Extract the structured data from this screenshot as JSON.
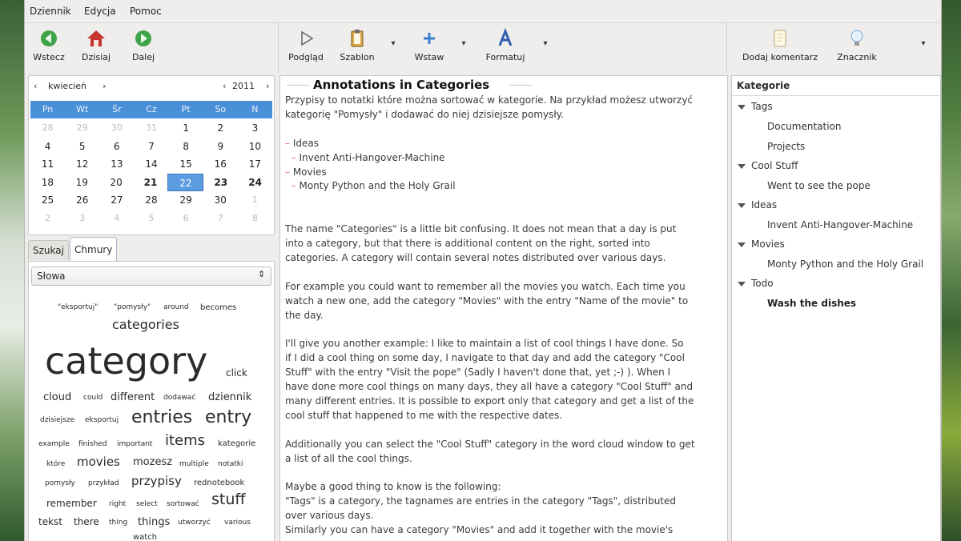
{
  "menubar": {
    "items": [
      "Dziennik",
      "Edycja",
      "Pomoc"
    ]
  },
  "toolbar": {
    "back": "Wstecz",
    "today": "Dzisiaj",
    "forward": "Dalej",
    "preview": "Podgląd",
    "template": "Szablon",
    "insert": "Wstaw",
    "format": "Formatuj",
    "add_comment": "Dodaj komentarz",
    "tag": "Znacznik"
  },
  "calendar": {
    "month": "kwiecień",
    "year": "2011",
    "weekdays": [
      "Pn",
      "Wt",
      "Śr",
      "Cz",
      "Pt",
      "So",
      "N"
    ],
    "weeks": [
      [
        "28",
        "29",
        "30",
        "31",
        "1",
        "2",
        "3"
      ],
      [
        "4",
        "5",
        "6",
        "7",
        "8",
        "9",
        "10"
      ],
      [
        "11",
        "12",
        "13",
        "14",
        "15",
        "16",
        "17"
      ],
      [
        "18",
        "19",
        "20",
        "21",
        "22",
        "23",
        "24"
      ],
      [
        "25",
        "26",
        "27",
        "28",
        "29",
        "30",
        "1"
      ],
      [
        "2",
        "3",
        "4",
        "5",
        "6",
        "7",
        "8"
      ]
    ],
    "selected_day": "22"
  },
  "left_tabs": {
    "search": "Szukaj",
    "clouds": "Chmury"
  },
  "cloud_combo": {
    "value": "Słowa"
  },
  "cloud_words": {
    "w1": "\"eksportuj\"",
    "w2": "\"pomysły\"",
    "w3": "around",
    "w4": "becomes",
    "w5": "categories",
    "w6": "category",
    "w7": "click",
    "w8": "cloud",
    "w9": "could",
    "w10": "different",
    "w11": "dodawać",
    "w12": "dziennik",
    "w13": "dzisiejsze",
    "w14": "eksportuj",
    "w15": "entries",
    "w16": "entry",
    "w17": "example",
    "w18": "finished",
    "w19": "important",
    "w20": "items",
    "w21": "kategorie",
    "w22": "które",
    "w23": "movies",
    "w24": "mozesz",
    "w25": "multiple",
    "w26": "notatki",
    "w27": "pomysły",
    "w28": "przykład",
    "w29": "przypisy",
    "w30": "rednotebook",
    "w31": "remember",
    "w32": "right",
    "w33": "select",
    "w34": "sortować",
    "w35": "stuff",
    "w36": "tekst",
    "w37": "there",
    "w38": "thing",
    "w39": "things",
    "w40": "utworzyć",
    "w41": "various",
    "w42": "watch"
  },
  "editor": {
    "title": "Annotations in Categories",
    "p1a": "Przypisy to notatki które można sortować w kategorie. Na przykład możesz utworzyć",
    "p1b": "kategorię \"Pomysły\" i dodawać do niej dzisiejsze pomysły.",
    "l1": "Ideas",
    "l2": "Invent Anti-Hangover-Machine",
    "l3": "Movies",
    "l4": "Monty Python and the Holy Grail",
    "p2a": "The name \"Categories\" is a little bit confusing. It does not mean that a day is put",
    "p2b": "into a category, but that there is additional content on the right, sorted into",
    "p2c": "categories. A category will contain several notes distributed over various days.",
    "p3a": "For example you could want to remember all the movies you watch. Each time you",
    "p3b": "watch a new one, add the category \"Movies\" with the entry \"Name of the movie\" to",
    "p3c": "the day.",
    "p4a": "I'll give you another example: I like to maintain a list of cool things I have done. So",
    "p4b": "if I did a cool thing on some day, I navigate to that day and add the category \"Cool",
    "p4c": "Stuff\" with the entry \"Visit the pope\" (Sadly I haven't done that, yet ;-) ). When I",
    "p4d": "have done more cool things on many days, they all have a category \"Cool Stuff\" and",
    "p4e": "many different entries. It is possible to export only that category and get a list of the",
    "p4f": "cool stuff that happened to me with the respective dates.",
    "p5a": "Additionally you can select the \"Cool Stuff\" category in the word cloud window to get",
    "p5b": "a list of all the cool things.",
    "p6a": "Maybe a good thing to know is the following:",
    "p6b": "\"Tags\" is a category, the tagnames are entries in the category \"Tags\", distributed",
    "p6c": "over various days.",
    "p6d": "Similarly you can have a category \"Movies\" and add it together with the movie's"
  },
  "categories_panel": {
    "header": "Kategorie",
    "tags": "Tags",
    "documentation": "Documentation",
    "projects": "Projects",
    "cool_stuff": "Cool Stuff",
    "went_pope": "Went to see the pope",
    "ideas": "Ideas",
    "invent": "Invent Anti-Hangover-Machine",
    "movies": "Movies",
    "monty": "Monty Python and the Holy Grail",
    "todo": "Todo",
    "wash": "Wash the dishes"
  },
  "colors": {
    "accent": "#4a90d9",
    "selected_day": "#5b9be0",
    "bullet": "#e07070"
  }
}
